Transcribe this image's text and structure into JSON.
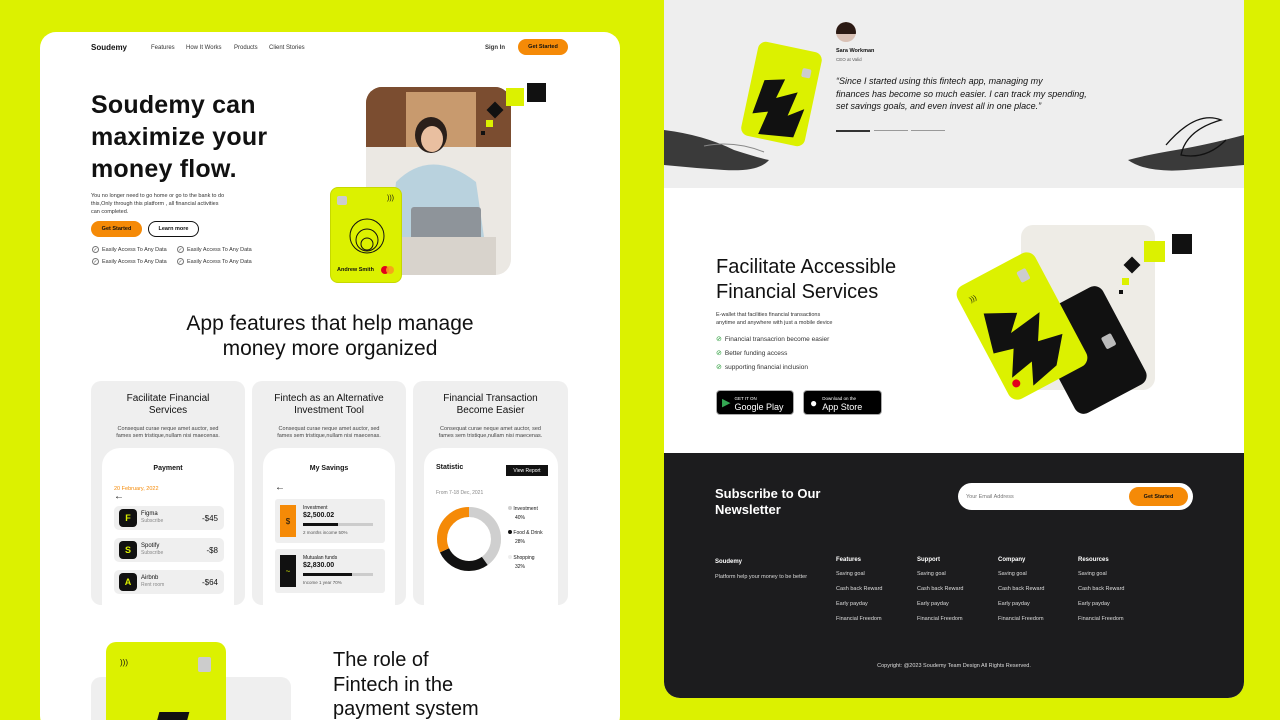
{
  "colors": {
    "accent": "#dcf100",
    "orange": "#f58a07",
    "dark": "#1c1c1e"
  },
  "nav": {
    "logo": "Soudemy",
    "links": [
      "Features",
      "How It Works",
      "Products",
      "Client Stories"
    ],
    "signin": "Sign In",
    "cta": "Get Started"
  },
  "hero": {
    "title_lines": [
      "Soudemy can",
      "maximize your",
      "money flow."
    ],
    "desc_lines": [
      "You no longer need to go home or go to the bank to do",
      "this,Only through this platform , all financial activities",
      "can completed."
    ],
    "primary": "Get Started",
    "secondary": "Learn more",
    "checks": [
      "Easily Access To Any Data",
      "Easily Access To Any Data",
      "Easily Access To Any Data",
      "Easily Access To Any Data"
    ],
    "card_name": "Andrew Smith"
  },
  "features": {
    "title_lines": [
      "App features that help manage",
      "money more organized"
    ],
    "cards": [
      {
        "title_lines": [
          "Facilitate Financial",
          "Services"
        ],
        "desc_lines": [
          "Consequat curae neque amet auctor, sed",
          "fames sem tristique,nullam nisi maecenas."
        ]
      },
      {
        "title_lines": [
          "Fintech as an Alternative",
          "Investment Tool"
        ],
        "desc_lines": [
          "Consequat curae neque amet auctor, sed",
          "fames sem tristique,nullam nisi maecenas."
        ]
      },
      {
        "title_lines": [
          "Financial Transaction",
          "Become Easier"
        ],
        "desc_lines": [
          "Consequat curae neque amet auctor, sed",
          "fames sem tristique,nullam nisi maecenas."
        ]
      }
    ],
    "payment": {
      "title": "Payment",
      "date": "20 February, 2022",
      "rows": [
        {
          "icon": "F",
          "name": "Figma",
          "sub": "Subscribe",
          "amount": "-$45"
        },
        {
          "icon": "S",
          "name": "Spotify",
          "sub": "Subscribe",
          "amount": "-$8"
        },
        {
          "icon": "A",
          "name": "Airbnb",
          "sub": "Rent room",
          "amount": "-$64"
        }
      ]
    },
    "savings": {
      "title": "My Savings",
      "items": [
        {
          "icon": "$",
          "label": "Investment",
          "amount": "$2,500.02",
          "note": "2 months income 50%",
          "progress": 0.5
        },
        {
          "icon": "~",
          "label": "Mutualan funds",
          "amount": "$2,830.00",
          "note": "Income 1 year 70%",
          "progress": 0.7
        }
      ]
    },
    "statistic": {
      "title": "Statistic",
      "button": "View Report",
      "range": "From 7-18 Dec, 2021",
      "legend": [
        {
          "label": "Investment",
          "value": "40%",
          "color": "#cfcfcf"
        },
        {
          "label": "Food & Drink",
          "value": "28%",
          "color": "#111111"
        },
        {
          "label": "Shopping",
          "value": "32%",
          "color": "#f58a07"
        }
      ]
    }
  },
  "role": {
    "title_lines": [
      "The role of",
      "Fintech in the",
      "payment system"
    ]
  },
  "testimonial": {
    "name": "Sara Workman",
    "role": "CEO at Valid",
    "quote_lines": [
      "“Since I started using this fintech app, managing my",
      "finances has become so much easier. I can track my spending,",
      "set savings goals, and even invest all in one place.”"
    ]
  },
  "facilitate": {
    "title_lines": [
      "Facilitate Accessible",
      "Financial Services"
    ],
    "desc_lines": [
      "E-wallet that facilities financial transactions",
      "anytime and anywhere with just a mobile device"
    ],
    "checks": [
      "Financial transacrion become easier",
      "Better funding access",
      "supporting financial inclusion"
    ],
    "gplay": {
      "small": "GET IT ON",
      "big": "Google Play"
    },
    "appstore": {
      "small": "Download on the",
      "big": "App Store"
    }
  },
  "newsletter": {
    "title_lines": [
      "Subscribe to Our",
      "Newsletter"
    ],
    "placeholder": "Your Email Address",
    "button": "Get Started"
  },
  "footer": {
    "brand": "Soudemy",
    "tagline": "Platform help your money to be better",
    "columns": [
      {
        "title": "Features",
        "items": [
          "Saving goal",
          "Cash back Reward",
          "Early payday",
          "Financial Freedom"
        ]
      },
      {
        "title": "Support",
        "items": [
          "Saving goal",
          "Cash back Reward",
          "Early payday",
          "Financial Freedom"
        ]
      },
      {
        "title": "Company",
        "items": [
          "Saving goal",
          "Cash back Reward",
          "Early payday",
          "Financial Freedom"
        ]
      },
      {
        "title": "Resources",
        "items": [
          "Saving goal",
          "Cash back Reward",
          "Early payday",
          "Financial Freedom"
        ]
      }
    ],
    "copyright": "Copyright: @2023 Soudemy Team Design All Rights Reserved."
  }
}
